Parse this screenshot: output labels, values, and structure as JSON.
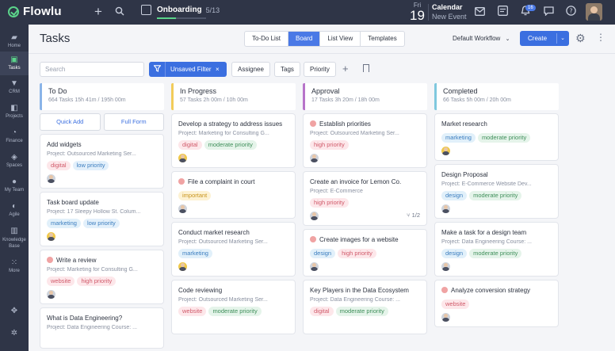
{
  "topbar": {
    "app_name": "Flowlu",
    "onboarding_label": "Onboarding",
    "onboarding_count": "5/13",
    "onboarding_progress": 0.385,
    "date_dow": "Fri",
    "date_day": "19",
    "calendar_title": "Calendar",
    "calendar_sub": "New Event",
    "notification_count": "16"
  },
  "sidebar": {
    "items": [
      {
        "label": "Home",
        "icon": "home-icon"
      },
      {
        "label": "Tasks",
        "icon": "tasks-icon"
      },
      {
        "label": "CRM",
        "icon": "crm-icon"
      },
      {
        "label": "Projects",
        "icon": "projects-icon"
      },
      {
        "label": "Finance",
        "icon": "finance-icon"
      },
      {
        "label": "Spaces",
        "icon": "spaces-icon"
      },
      {
        "label": "My Team",
        "icon": "team-icon"
      },
      {
        "label": "Agile",
        "icon": "agile-icon"
      },
      {
        "label": "Knowledge",
        "label2": "Base",
        "icon": "book-icon"
      },
      {
        "label": "More",
        "icon": "grid-icon"
      }
    ]
  },
  "header": {
    "title": "Tasks",
    "tabs": [
      "To-Do List",
      "Board",
      "List View",
      "Templates"
    ],
    "active_tab": "Board",
    "workflow": "Default Workflow",
    "create_label": "Create"
  },
  "filters": {
    "search_placeholder": "Search",
    "unsaved_filter": "Unsaved Filter",
    "assignee": "Assignee",
    "tags": "Tags",
    "priority": "Priority"
  },
  "columns": [
    {
      "name": "To Do",
      "meta": "664 Tasks  15h 41m / 195h 00m",
      "color": "#8ab4e8",
      "quick_add": "Quick Add",
      "full_form": "Full Form",
      "cards": [
        {
          "title": "Add widgets",
          "project": "Project: Outsourced Marketing Ser...",
          "tags": [
            [
              "digital",
              "t-digital"
            ],
            [
              "low priority",
              "t-lowp"
            ]
          ],
          "avatar": "male"
        },
        {
          "title": "Task board update",
          "project": "Project: 17 Sleepy Hollow St. Colum...",
          "tags": [
            [
              "marketing",
              "t-marketing"
            ],
            [
              "low priority",
              "t-lowp"
            ]
          ],
          "avatar": "female"
        },
        {
          "title": "Write a review",
          "prio": true,
          "project": "Project: Marketing for Consulting G...",
          "tags": [
            [
              "website",
              "t-website"
            ],
            [
              "high priority",
              "t-highp"
            ]
          ],
          "avatar": "male"
        },
        {
          "title": "What is Data Engineering?",
          "project": "Project: Data Engineering Course: ...",
          "tags": [],
          "avatar": ""
        }
      ]
    },
    {
      "name": "In Progress",
      "meta": "57 Tasks  2h 00m / 10h 00m",
      "color": "#f2cc5a",
      "cards": [
        {
          "title": "Develop a strategy to address issues",
          "project": "Project: Marketing for Consulting G...",
          "tags": [
            [
              "digital",
              "t-digital"
            ],
            [
              "moderate priority",
              "t-modp"
            ]
          ],
          "avatar": "female"
        },
        {
          "title": "File a complaint in court",
          "prio": true,
          "project": "",
          "tags": [
            [
              "important",
              "t-important"
            ]
          ],
          "avatar": "male"
        },
        {
          "title": "Conduct market research",
          "project": "Project: Outsourced Marketing Ser...",
          "tags": [
            [
              "marketing",
              "t-marketing"
            ]
          ],
          "avatar": "female"
        },
        {
          "title": "Code reviewing",
          "project": "Project: Outsourced Marketing Ser...",
          "tags": [
            [
              "website",
              "t-website"
            ],
            [
              "moderate priority",
              "t-modp"
            ]
          ],
          "avatar": ""
        }
      ]
    },
    {
      "name": "Approval",
      "meta": "17 Tasks  3h 20m / 18h 00m",
      "color": "#b774c9",
      "cards": [
        {
          "title": "Establish priorities",
          "prio": true,
          "project": "Project: Outsourced Marketing Ser...",
          "tags": [
            [
              "high priority",
              "t-highp"
            ]
          ],
          "avatar": "male"
        },
        {
          "title": "Create an invoice for Lemon Co.",
          "project": "Project: E-Commerce",
          "tags": [
            [
              "high priority",
              "t-highp"
            ]
          ],
          "avatar": "male",
          "subtask": "1/2"
        },
        {
          "title": "Create images for a website",
          "prio": true,
          "project": "",
          "tags": [
            [
              "design",
              "t-design"
            ],
            [
              "high priority",
              "t-highp"
            ]
          ],
          "avatar": "male"
        },
        {
          "title": "Key Players in the Data Ecosystem",
          "project": "Project: Data Engineering Course: ...",
          "tags": [
            [
              "digital",
              "t-digital"
            ],
            [
              "moderate priority",
              "t-modp"
            ]
          ],
          "avatar": ""
        }
      ]
    },
    {
      "name": "Completed",
      "meta": "66 Tasks  5h 00m / 20h 00m",
      "color": "#7fc8de",
      "cards": [
        {
          "title": "Market research",
          "project": "",
          "tags": [
            [
              "marketing",
              "t-marketing"
            ],
            [
              "moderate priority",
              "t-modp"
            ]
          ],
          "avatar": "female"
        },
        {
          "title": "Design Proposal",
          "project": "Project: E-Commerce Website Dev...",
          "tags": [
            [
              "design",
              "t-design"
            ],
            [
              "moderate priority",
              "t-modp"
            ]
          ],
          "avatar": "male"
        },
        {
          "title": "Make a task for a design team",
          "project": "Project: Data Engineering Course: ...",
          "tags": [
            [
              "design",
              "t-design"
            ],
            [
              "moderate priority",
              "t-modp"
            ]
          ],
          "avatar": "male"
        },
        {
          "title": "Analyze conversion strategy",
          "prio": true,
          "project": "",
          "tags": [
            [
              "website",
              "t-website"
            ]
          ],
          "avatar": "male"
        }
      ]
    }
  ]
}
